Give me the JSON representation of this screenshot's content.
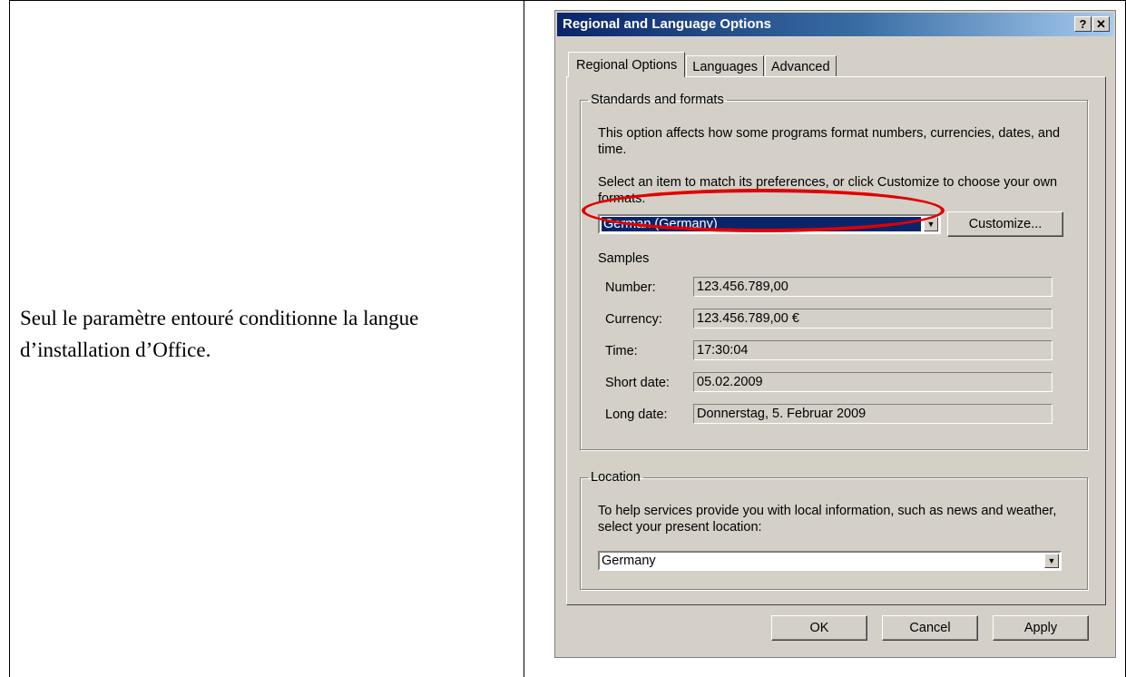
{
  "caption": "Seul le paramètre entouré conditionne la langue d’installation d’Office.",
  "dialog": {
    "title": "Regional and Language Options",
    "help_label": "?",
    "close_label": "✕",
    "tabs": [
      "Regional Options",
      "Languages",
      "Advanced"
    ],
    "standards": {
      "legend": "Standards and formats",
      "desc": "This option affects how some programs format numbers, currencies, dates, and time.",
      "select_prompt": "Select an item to match its preferences, or click Customize to choose your own formats:",
      "selected_format": "German (Germany)",
      "customize_label": "Customize...",
      "samples_heading": "Samples",
      "samples": [
        {
          "label": "Number:",
          "value": "123.456.789,00"
        },
        {
          "label": "Currency:",
          "value": "123.456.789,00 €"
        },
        {
          "label": "Time:",
          "value": "17:30:04"
        },
        {
          "label": "Short date:",
          "value": "05.02.2009"
        },
        {
          "label": "Long date:",
          "value": "Donnerstag, 5. Februar 2009"
        }
      ]
    },
    "location": {
      "legend": "Location",
      "desc": "To help services provide you with local information, such as news and weather, select your present location:",
      "selected": "Germany"
    },
    "buttons": {
      "ok": "OK",
      "cancel": "Cancel",
      "apply": "Apply"
    }
  },
  "colors": {
    "highlight": "#e00000",
    "titlebar": "#0a246a",
    "face": "#d4d0c8"
  }
}
